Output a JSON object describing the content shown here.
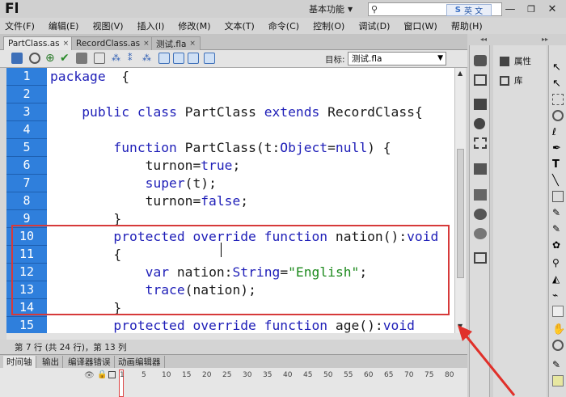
{
  "app": {
    "logo": "Fl",
    "workspace": "基本功能",
    "ime": "英 文"
  },
  "menu": [
    "文件(F)",
    "编辑(E)",
    "视图(V)",
    "插入(I)",
    "修改(M)",
    "文本(T)",
    "命令(C)",
    "控制(O)",
    "调试(D)",
    "窗口(W)",
    "帮助(H)"
  ],
  "tabs": [
    {
      "label": "PartClass.as",
      "active": true
    },
    {
      "label": "RecordClass.as",
      "active": false
    },
    {
      "label": "测试.fla",
      "active": false
    }
  ],
  "toolbar": {
    "target_label": "目标:",
    "target_value": "测试.fla"
  },
  "editor": {
    "line_numbers": [
      "1",
      "2",
      "3",
      "4",
      "5",
      "6",
      "7",
      "8",
      "9",
      "10",
      "11",
      "12",
      "13",
      "14",
      "15"
    ]
  },
  "status": {
    "text": "第 7 行 (共 24 行)，第 13 列"
  },
  "bottom_tabs": [
    "时间轴",
    "输出",
    "编译器错误",
    "动画编辑器"
  ],
  "timeline": {
    "frames": [
      "1",
      "5",
      "10",
      "15",
      "20",
      "25",
      "30",
      "35",
      "40",
      "45",
      "50",
      "55",
      "60",
      "65",
      "70",
      "75",
      "80"
    ]
  },
  "right_panel": {
    "properties": "属性",
    "library": "库"
  },
  "colors": {
    "gutter": "#2f7fdc",
    "keyword": "#1f1fb8",
    "string": "#1d8a1d",
    "annotation": "#d63a3a"
  }
}
